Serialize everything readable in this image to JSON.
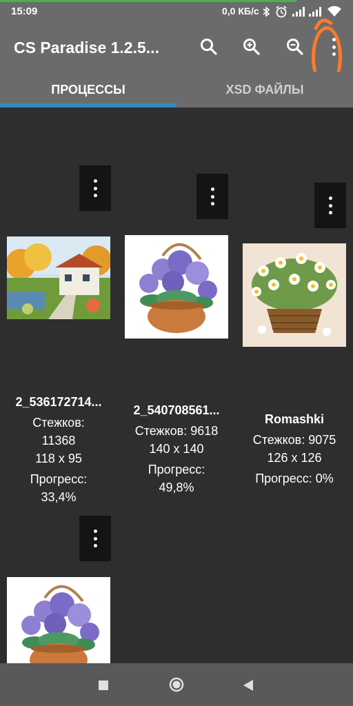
{
  "status_bar": {
    "time": "15:09",
    "network_speed": "0,0 КБ/с",
    "icons": [
      "bluetooth-icon",
      "alarm-icon",
      "signal-icon",
      "signal-icon",
      "wifi-icon"
    ]
  },
  "toolbar": {
    "title": "CS Paradise 1.2.5...",
    "actions": [
      "search-icon",
      "zoom-in-icon",
      "zoom-out-icon",
      "more-vert-icon"
    ]
  },
  "tabs": [
    {
      "label": "ПРОЦЕССЫ",
      "active": true
    },
    {
      "label": "XSD ФАЙЛЫ",
      "active": false
    }
  ],
  "items": [
    {
      "name": "2_536172714...",
      "stitches": "Стежков: 11368",
      "stitches_label": "Стежков:",
      "stitches_value": "11368",
      "size": "118 x 95",
      "progress_label": "Прогресс:",
      "progress_value": "33,4%"
    },
    {
      "name": "2_540708561...",
      "stitches": "Стежков: 9618",
      "size": "140 x 140",
      "progress_label": "Прогресс:",
      "progress_value": "49,8%"
    },
    {
      "name": "Romashki",
      "stitches": "Стежков: 9075",
      "size": "126 x 126",
      "progress": "Прогресс: 0%"
    }
  ],
  "accent_colors": {
    "toolbar": "#6b6b6b",
    "tab_indicator": "#2e8cc7",
    "annotation": "#ff7a2a",
    "background": "#2e2e2e"
  },
  "nav": [
    "recents-icon",
    "home-icon",
    "back-icon"
  ]
}
